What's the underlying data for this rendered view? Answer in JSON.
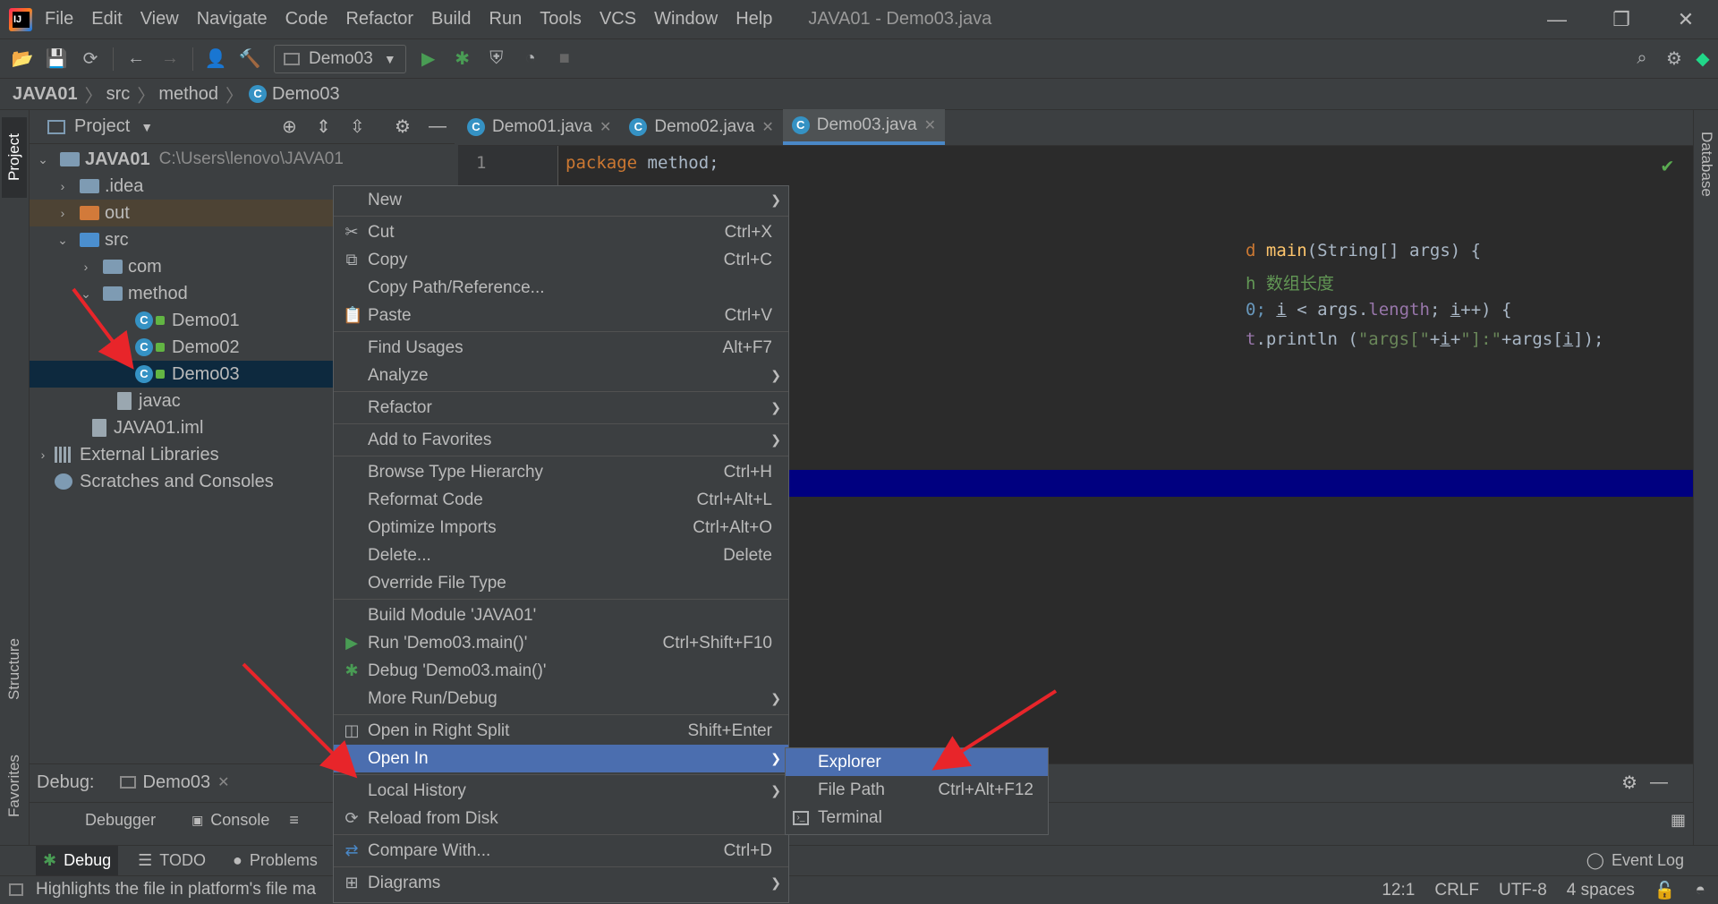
{
  "window": {
    "title": "JAVA01 - Demo03.java",
    "menus": [
      "File",
      "Edit",
      "View",
      "Navigate",
      "Code",
      "Refactor",
      "Build",
      "Run",
      "Tools",
      "VCS",
      "Window",
      "Help"
    ],
    "controls": {
      "minimize": "—",
      "restore": "❐",
      "close": "✕"
    }
  },
  "toolbar": {
    "run_config": "Demo03"
  },
  "breadcrumb": [
    "JAVA01",
    "src",
    "method",
    "Demo03"
  ],
  "left_strip": {
    "project": "Project",
    "structure": "Structure",
    "favorites": "Favorites"
  },
  "right_strip": {
    "database": "Database"
  },
  "project_panel": {
    "title": "Project",
    "tree": [
      {
        "label": "JAVA01",
        "hint": "C:\\Users\\lenovo\\JAVA01"
      },
      {
        "label": ".idea"
      },
      {
        "label": "out"
      },
      {
        "label": "src"
      },
      {
        "label": "com"
      },
      {
        "label": "method"
      },
      {
        "label": "Demo01"
      },
      {
        "label": "Demo02"
      },
      {
        "label": "Demo03"
      },
      {
        "label": "javac"
      },
      {
        "label": "JAVA01.iml"
      },
      {
        "label": "External Libraries"
      },
      {
        "label": "Scratches and Consoles"
      }
    ]
  },
  "editor": {
    "tabs": [
      {
        "label": "Demo01.java"
      },
      {
        "label": "Demo02.java"
      },
      {
        "label": "Demo03.java"
      }
    ],
    "line_numbers": [
      "1"
    ],
    "code": {
      "l1_kw": "package",
      "l1_rest": " method;",
      "l2_a": "d ",
      "l2_fn": "main",
      "l2_rest": "(String[] args) {",
      "l3_a": "h ",
      "l3_cmt": "数组长度",
      "l4_a": "0; ",
      "l4_b": "i",
      "l4_c": " < args.",
      "l4_fld": "length",
      "l4_d": "; ",
      "l4_e": "i",
      "l4_f": "++) {",
      "l5_a": "t",
      "l5_b": ".println (",
      "l5_s1": "\"args[\"",
      "l5_c": "+",
      "l5_i": "i",
      "l5_d": "+",
      "l5_s2": "\"]:\"",
      "l5_e": "+args[",
      "l5_i2": "i",
      "l5_f": "]);"
    }
  },
  "context_menu": {
    "items": [
      {
        "label": "New",
        "shortcut": ""
      },
      {
        "label": "Cut",
        "shortcut": "Ctrl+X"
      },
      {
        "label": "Copy",
        "shortcut": "Ctrl+C"
      },
      {
        "label": "Copy Path/Reference...",
        "shortcut": ""
      },
      {
        "label": "Paste",
        "shortcut": "Ctrl+V"
      },
      {
        "label": "Find Usages",
        "shortcut": "Alt+F7"
      },
      {
        "label": "Analyze",
        "shortcut": ""
      },
      {
        "label": "Refactor",
        "shortcut": ""
      },
      {
        "label": "Add to Favorites",
        "shortcut": ""
      },
      {
        "label": "Browse Type Hierarchy",
        "shortcut": "Ctrl+H"
      },
      {
        "label": "Reformat Code",
        "shortcut": "Ctrl+Alt+L"
      },
      {
        "label": "Optimize Imports",
        "shortcut": "Ctrl+Alt+O"
      },
      {
        "label": "Delete...",
        "shortcut": "Delete"
      },
      {
        "label": "Override File Type",
        "shortcut": ""
      },
      {
        "label": "Build Module 'JAVA01'",
        "shortcut": ""
      },
      {
        "label": "Run 'Demo03.main()'",
        "shortcut": "Ctrl+Shift+F10"
      },
      {
        "label": "Debug 'Demo03.main()'",
        "shortcut": ""
      },
      {
        "label": "More Run/Debug",
        "shortcut": ""
      },
      {
        "label": "Open in Right Split",
        "shortcut": "Shift+Enter"
      },
      {
        "label": "Open In",
        "shortcut": ""
      },
      {
        "label": "Local History",
        "shortcut": ""
      },
      {
        "label": "Reload from Disk",
        "shortcut": ""
      },
      {
        "label": "Compare With...",
        "shortcut": "Ctrl+D"
      },
      {
        "label": "Diagrams",
        "shortcut": ""
      }
    ]
  },
  "submenu": {
    "items": [
      {
        "label": "Explorer",
        "shortcut": ""
      },
      {
        "label": "File Path",
        "shortcut": "Ctrl+Alt+F12"
      },
      {
        "label": "Terminal",
        "shortcut": ""
      }
    ]
  },
  "debug_panel": {
    "label": "Debug:",
    "session": "Demo03",
    "tabs": [
      "Debugger",
      "Console"
    ]
  },
  "bottom_tabs": {
    "debug": "Debug",
    "todo": "TODO",
    "problems": "Problems",
    "event_log": "Event Log"
  },
  "statusbar": {
    "message": "Highlights the file in platform's file ma",
    "position": "12:1",
    "line_sep": "CRLF",
    "encoding": "UTF-8",
    "indent": "4 spaces"
  },
  "colors": {
    "accent": "#4b6eaf",
    "selection": "#0d293e",
    "debug_line": "#000080",
    "annotation_arrow": "#e8252a"
  }
}
